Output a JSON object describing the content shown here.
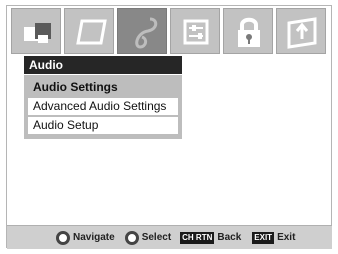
{
  "menu": {
    "title": "Audio",
    "items": [
      {
        "label": "Audio Settings",
        "selected": true
      },
      {
        "label": "Advanced Audio Settings",
        "selected": false
      },
      {
        "label": "Audio Setup",
        "selected": false
      }
    ]
  },
  "icon_bar": [
    {
      "icon": "picture-icon",
      "selected": false
    },
    {
      "icon": "screen-icon",
      "selected": false
    },
    {
      "icon": "audio-icon",
      "selected": true
    },
    {
      "icon": "settings-sliders-icon",
      "selected": false
    },
    {
      "icon": "lock-icon",
      "selected": false
    },
    {
      "icon": "setup-icon",
      "selected": false
    }
  ],
  "nav": {
    "navigate_label": "Navigate",
    "select_label": "Select",
    "back_key": "CH RTN",
    "back_label": "Back",
    "exit_key": "EXIT",
    "exit_label": "Exit"
  },
  "colors": {
    "header_bg": "#262626",
    "selected_item_bg": "#bdbdbd",
    "selected_tab_bg": "#888888"
  }
}
